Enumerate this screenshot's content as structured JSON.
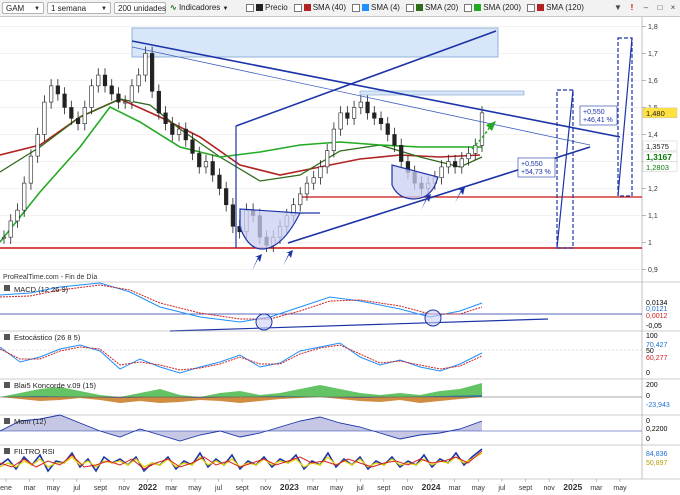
{
  "toolbar": {
    "symbol": "GAM",
    "timeframe": "1 semana",
    "units": "200 unidades",
    "indicators_label": "Indicadores",
    "legend": [
      {
        "label": "Precio",
        "color": "#222222"
      },
      {
        "label": "SMA (40)",
        "color": "#b22222"
      },
      {
        "label": "SMA (4)",
        "color": "#1e90ff"
      },
      {
        "label": "SMA (20)",
        "color": "#2e6b1a"
      },
      {
        "label": "SMA (200)",
        "color": "#22aa22"
      },
      {
        "label": "SMA (120)",
        "color": "#b22222"
      }
    ]
  },
  "watermark": "ProRealTime.com - Fin de Día",
  "chart_data": [
    {
      "type": "line",
      "pane": "price",
      "x_labels": [
        "ene",
        "mar",
        "may",
        "jul",
        "sept",
        "nov",
        "2022",
        "mar",
        "may",
        "jul",
        "sept",
        "nov",
        "2023",
        "mar",
        "may",
        "jul",
        "sept",
        "nov",
        "2024",
        "mar",
        "may",
        "jul",
        "sept",
        "nov",
        "2025",
        "mar",
        "may"
      ],
      "ylim": [
        0.88,
        1.82
      ],
      "y_ticks": [
        0.9,
        1,
        1.1,
        1.2,
        1.3,
        1.4,
        1.5,
        1.6,
        1.7,
        1.8
      ],
      "y_tick_labels": [
        "0,9",
        "1",
        "1,1",
        "1,2",
        "1,3",
        "1,4",
        "1,5",
        "1,6",
        "1,7",
        "1,8"
      ],
      "series": [
        {
          "name": "Precio",
          "values": [
            1.02,
            1.08,
            1.12,
            1.22,
            1.32,
            1.4,
            1.52,
            1.58,
            1.55,
            1.5,
            1.46,
            1.44,
            1.5,
            1.58,
            1.62,
            1.58,
            1.55,
            1.52,
            1.52,
            1.58,
            1.62,
            1.7,
            1.56,
            1.48,
            1.44,
            1.4,
            1.42,
            1.38,
            1.33,
            1.28,
            1.3,
            1.25,
            1.2,
            1.14,
            1.06,
            1.04,
            1.12,
            1.1,
            1.02,
            0.99,
            1.02,
            1.06,
            1.1,
            1.14,
            1.18,
            1.22,
            1.24,
            1.28,
            1.34,
            1.42,
            1.48,
            1.46,
            1.5,
            1.52,
            1.48,
            1.46,
            1.44,
            1.4,
            1.36,
            1.3,
            1.26,
            1.22,
            1.2,
            1.22,
            1.24,
            1.28,
            1.3,
            1.28,
            1.31,
            1.33,
            1.36,
            1.48
          ]
        }
      ],
      "readouts": [
        {
          "label": "1,480",
          "value": 1.48,
          "bg": "#ffe23f",
          "color": "#222222"
        },
        {
          "label": "1,3575",
          "value": 1.3575,
          "bg": "#ffffff",
          "color": "#222222"
        },
        {
          "label": "1,3167",
          "value": 1.3167,
          "bg": "#ffffff",
          "color": "#0a7a0a"
        },
        {
          "label": "1,2803",
          "value": 1.2803,
          "bg": "#ffffff",
          "color": "#0a7a0a"
        }
      ],
      "annotations": [
        {
          "label": "+0,550",
          "line2": "+46,41 %"
        },
        {
          "label": "+0,550",
          "line2": "+54,73 %"
        }
      ]
    },
    {
      "type": "line",
      "pane": "MACD",
      "title": "MACD (12 26 9)",
      "ylim": [
        -0.07,
        0.06
      ],
      "y_tick_labels": [
        "0,0134",
        "0,0121",
        "0,0012",
        "-0,05"
      ]
    },
    {
      "type": "line",
      "pane": "Estocástico",
      "title": "Estocástico (26 8 5)",
      "ylim": [
        0,
        100
      ],
      "y_tick_labels": [
        "100",
        "70,427",
        "50",
        "60,277",
        "0"
      ]
    },
    {
      "type": "area",
      "pane": "Koncorde",
      "title": "Blai5 Koncorde v.09 (15)",
      "ylim": [
        -200,
        200
      ],
      "y_tick_labels": [
        "200",
        "0",
        "-23,943"
      ]
    },
    {
      "type": "area",
      "pane": "Mom",
      "title": "Mom (12)",
      "ylim": [
        -0.3,
        0.3
      ],
      "y_tick_labels": [
        "0",
        "0,2200",
        "0"
      ]
    },
    {
      "type": "line",
      "pane": "FILTRO RSI",
      "title": "FILTRO RSI",
      "ylim": [
        0,
        100
      ],
      "y_tick_labels": [
        "84,836",
        "50,897"
      ]
    }
  ]
}
